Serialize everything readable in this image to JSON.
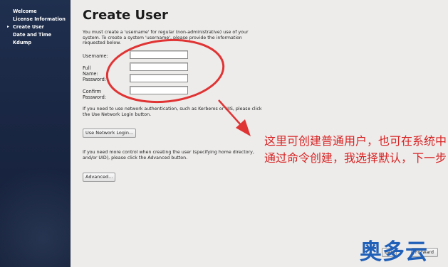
{
  "sidebar": {
    "items": [
      {
        "label": "Welcome",
        "current": false
      },
      {
        "label": "License Information",
        "current": false
      },
      {
        "label": "Create User",
        "current": true
      },
      {
        "label": "Date and Time",
        "current": false
      },
      {
        "label": "Kdump",
        "current": false
      }
    ],
    "current_marker": "▸"
  },
  "main": {
    "title": "Create User",
    "intro": "You must create a 'username' for regular (non-administrative) use of your system.  To create a system 'username', please provide the information requested below.",
    "fields": [
      {
        "label": "Username:",
        "value": ""
      },
      {
        "label": "Full Name:",
        "value": ""
      },
      {
        "label": "Password:",
        "value": ""
      },
      {
        "label": "Confirm Password:",
        "value": ""
      }
    ],
    "network_note": "If you need to use network authentication, such as Kerberos or NIS, please click the Use Network Login button.",
    "network_button": "Use Network Login...",
    "advanced_note": "If you need more control when creating the user (specifying home directory, and/or UID), please click the Advanced button.",
    "advanced_button": "Advanced...",
    "back_button": "Back",
    "forward_button": "Forward"
  },
  "annotation": {
    "text": "这里可创建普通用户，也可在系统中通过命令创建，我选择默认，下一步",
    "color": "#d92424"
  },
  "watermark": {
    "text": "奥多云",
    "color": "#2160b8"
  }
}
